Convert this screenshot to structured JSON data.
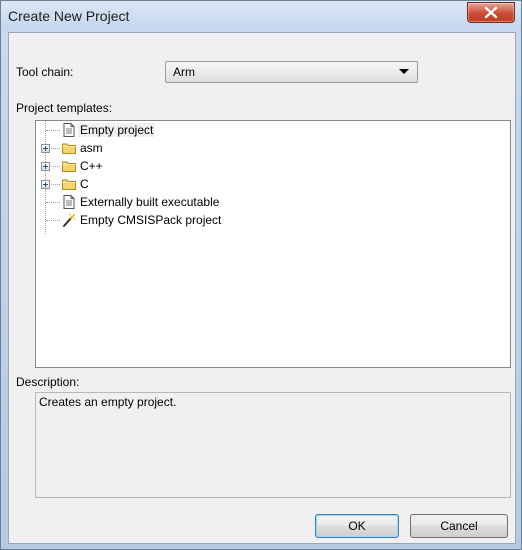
{
  "window": {
    "title": "Create New Project"
  },
  "toolchain": {
    "label": "Tool chain:",
    "value": "Arm"
  },
  "templates": {
    "label": "Project templates:",
    "items": [
      {
        "label": "Empty project",
        "icon": "document-icon",
        "expandable": false,
        "selected": true
      },
      {
        "label": "asm",
        "icon": "folder-icon",
        "expandable": true
      },
      {
        "label": "C++",
        "icon": "folder-icon",
        "expandable": true
      },
      {
        "label": "C",
        "icon": "folder-icon",
        "expandable": true
      },
      {
        "label": "Externally built executable",
        "icon": "document-icon",
        "expandable": false
      },
      {
        "label": "Empty CMSISPack project",
        "icon": "wizard-wand-icon",
        "expandable": false
      }
    ]
  },
  "description": {
    "label": "Description:",
    "text": "Creates an empty project."
  },
  "buttons": {
    "ok": "OK",
    "cancel": "Cancel"
  },
  "colors": {
    "close_button": "#c94b33",
    "window_frame": "#b5c9e3",
    "dialog_bg": "#f0f0f0"
  }
}
